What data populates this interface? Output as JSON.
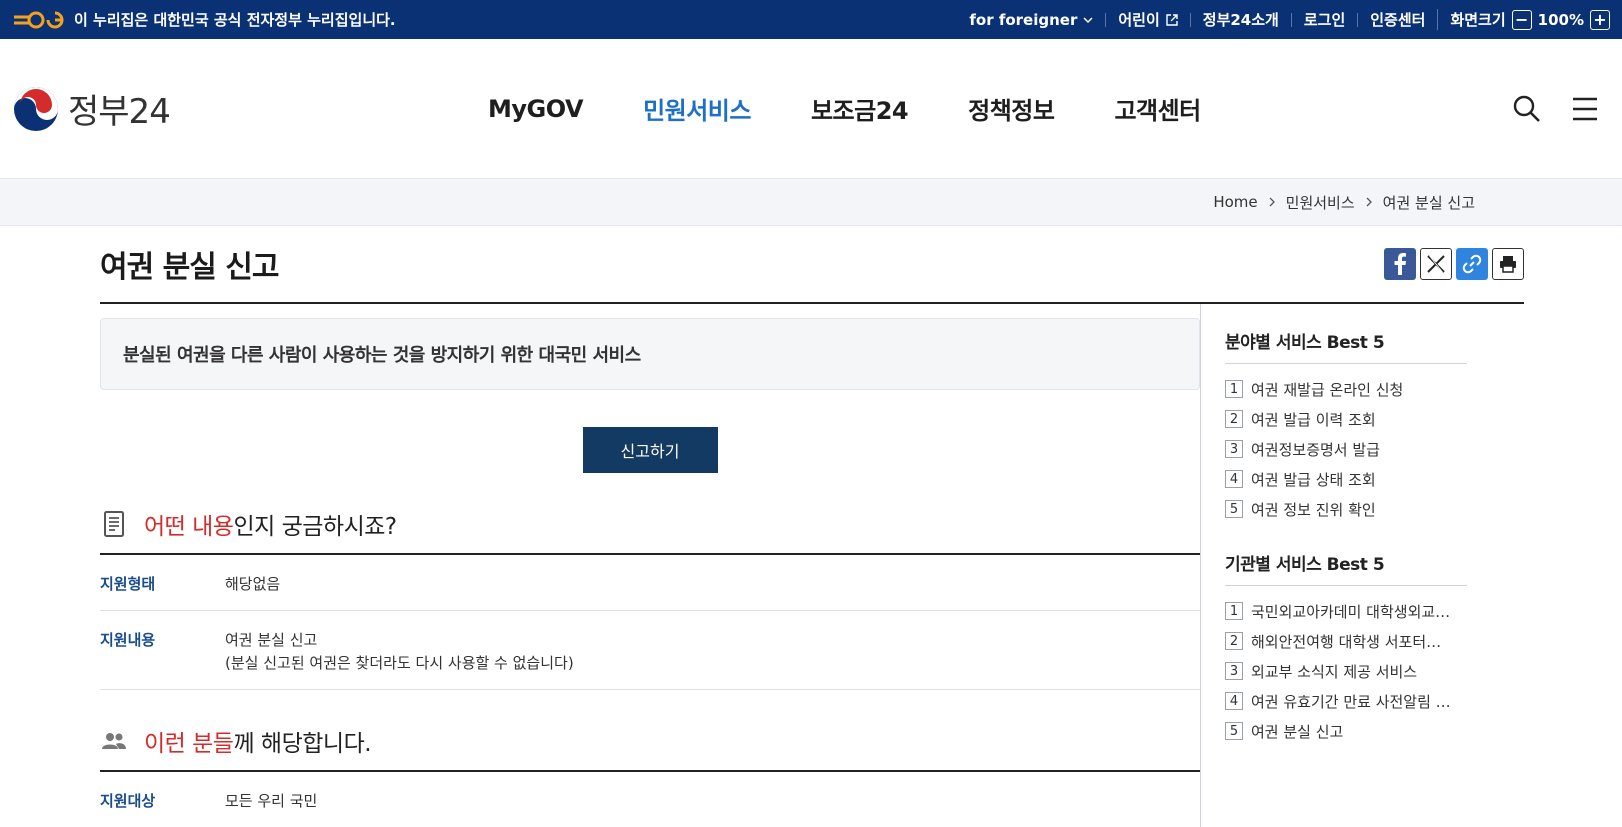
{
  "topbar": {
    "notice": "이 누리집은 대한민국 공식 전자정부 누리집입니다.",
    "items": [
      {
        "label": "for foreigner"
      },
      {
        "label": "어린이"
      },
      {
        "label": "정부24소개"
      },
      {
        "label": "로그인"
      },
      {
        "label": "인증센터"
      },
      {
        "label": "화면크기"
      }
    ],
    "zoom_minus": "−",
    "zoom_value": "100%",
    "zoom_plus": "+"
  },
  "brand": {
    "name": "정부24"
  },
  "gnb": {
    "items": [
      {
        "label": "MyGOV"
      },
      {
        "label": "민원서비스"
      },
      {
        "label": "보조금24"
      },
      {
        "label": "정책정보"
      },
      {
        "label": "고객센터"
      }
    ]
  },
  "breadcrumb": {
    "items": [
      "Home",
      "민원서비스",
      "여권 분실 신고"
    ]
  },
  "page": {
    "title": "여권 분실 신고",
    "summary": "분실된 여권을 다른 사람이 사용하는 것을 방지하기 위한 대국민 서비스",
    "cta_label": "신고하기"
  },
  "section_what": {
    "highlight": "어떤 내용",
    "rest": "인지 궁금하시죠?",
    "rows": [
      {
        "label": "지원형태",
        "value": "해당없음",
        "value2": ""
      },
      {
        "label": "지원내용",
        "value": "여권 분실 신고",
        "value2": "(분실 신고된 여권은 찾더라도 다시 사용할 수 없습니다)"
      }
    ]
  },
  "section_who": {
    "highlight": "이런 분들",
    "rest": "께 해당합니다.",
    "rows": [
      {
        "label": "지원대상",
        "value": "모든 우리 국민"
      }
    ]
  },
  "aside": {
    "field_best": {
      "title": "분야별 서비스 Best 5",
      "items": [
        {
          "num": "1",
          "label": "여권 재발급 온라인 신청"
        },
        {
          "num": "2",
          "label": "여권 발급 이력 조회"
        },
        {
          "num": "3",
          "label": "여권정보증명서 발급"
        },
        {
          "num": "4",
          "label": "여권 발급 상태 조회"
        },
        {
          "num": "5",
          "label": "여권 정보 진위 확인"
        }
      ]
    },
    "agency_best": {
      "title": "기관별 서비스 Best 5",
      "items": [
        {
          "num": "1",
          "label": "국민외교아카데미 대학생외교…"
        },
        {
          "num": "2",
          "label": "해외안전여행 대학생 서포터스…"
        },
        {
          "num": "3",
          "label": "외교부 소식지 제공 서비스"
        },
        {
          "num": "4",
          "label": "여권 유효기간 만료 사전알림 …"
        },
        {
          "num": "5",
          "label": "여권 분실 신고"
        }
      ]
    }
  },
  "colors": {
    "topbar_bg": "#0b3175",
    "active_nav": "#1d6fc8",
    "cta_bg": "#133a62",
    "highlight_red": "#d42b2b",
    "label_blue": "#1a4d8c"
  }
}
